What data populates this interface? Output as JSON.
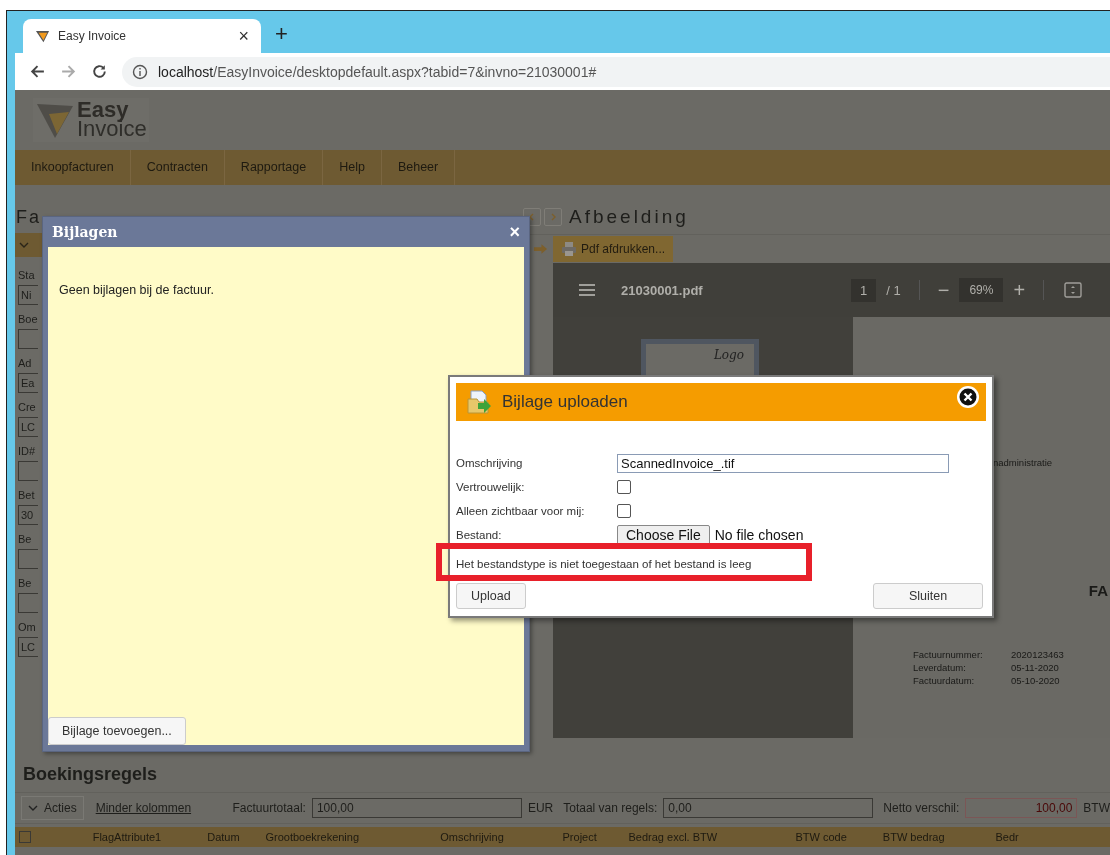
{
  "browser": {
    "tab": {
      "title": "Easy Invoice",
      "close": "×"
    },
    "new_tab": "+",
    "address": {
      "host": "localhost",
      "path": "/EasyInvoice/desktopdefault.aspx?tabid=7&invno=21030001#"
    }
  },
  "logo": {
    "line1": "Easy",
    "line2": "Invoice"
  },
  "nav": [
    {
      "label": "Inkoopfacturen"
    },
    {
      "label": "Contracten"
    },
    {
      "label": "Rapportage"
    },
    {
      "label": "Help"
    },
    {
      "label": "Beheer"
    }
  ],
  "left_panel": {
    "title": "Fa",
    "fields": [
      {
        "label": "Sta",
        "value": "Ni"
      },
      {
        "label": "Boe"
      },
      {
        "label": "Ad",
        "value": "Ea"
      },
      {
        "label": "Cre",
        "value": "LC"
      },
      {
        "label": "ID#"
      },
      {
        "label": "Bet",
        "value": "30"
      },
      {
        "label": "Be"
      },
      {
        "label": "Be"
      },
      {
        "label": "Om",
        "value": "LC"
      }
    ]
  },
  "image_panel": {
    "title": "Afbeelding",
    "print_button": "Pdf afdrukken...",
    "viewer": {
      "file_name": "21030001.pdf",
      "page": "1",
      "page_total": "/ 1",
      "zoom_out": "−",
      "zoom": "69%",
      "zoom_in": "+",
      "thumbnail_text": "Logo",
      "company": "nadministratie",
      "heading": "FA",
      "details": [
        {
          "label": "Factuurnummer:",
          "value": "2020123463"
        },
        {
          "label": "Leverdatum:",
          "value": "05-11-2020"
        },
        {
          "label": "Factuurdatum:",
          "value": "05-10-2020"
        }
      ]
    }
  },
  "bijlagen_dialog": {
    "title": "Bijlagen",
    "close": "×",
    "message": "Geen bijlagen bij de factuur.",
    "add_button": "Bijlage toevoegen..."
  },
  "upload_dialog": {
    "title": "Bijlage uploaden",
    "fields": [
      {
        "kind": "text",
        "label": "Omschrijving",
        "value": "ScannedInvoice_.tif"
      },
      {
        "kind": "checkbox",
        "label": "Vertrouwelijk:",
        "checked": false
      },
      {
        "kind": "checkbox",
        "label": "Alleen zichtbaar voor mij:",
        "checked": false
      },
      {
        "kind": "file",
        "label": "Bestand:",
        "button": "Choose File",
        "status": "No file chosen"
      }
    ],
    "error": "Het bestandstype is niet toegestaan of het bestand is leeg",
    "upload_button": "Upload",
    "close_button": "Sluiten"
  },
  "bookings": {
    "title": "Boekingsregels",
    "actions": "Acties",
    "toggle_link": "Minder kolommen",
    "totals": [
      {
        "label": "Factuurtotaal:",
        "value": "100,00",
        "unit": "EUR",
        "kind": "normal"
      },
      {
        "label": "Totaal van regels:",
        "value": "0,00",
        "kind": "normal"
      },
      {
        "label": "Netto verschil:",
        "value": "100,00",
        "unit": "BTW",
        "kind": "difference"
      }
    ],
    "select_all_checked": false,
    "columns": [
      "FlagAttribute1",
      "Datum",
      "Grootboekrekening",
      "Omschrijving",
      "Project",
      "Bedrag excl. BTW",
      "BTW code",
      "BTW bedrag",
      "Bedr"
    ]
  }
}
